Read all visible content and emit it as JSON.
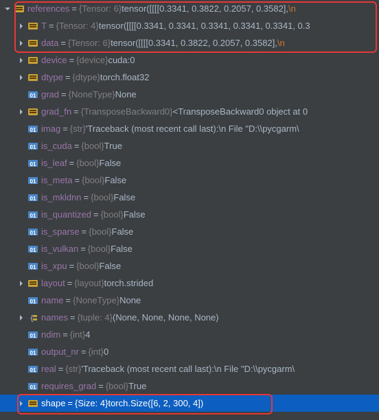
{
  "rows": [
    {
      "id": "references",
      "indent": 0,
      "expand": "down",
      "icon": "struct",
      "name": "references",
      "type": "{Tensor: 6}",
      "value": "tensor([[[[0.3341, 0.3822, 0.2057, 0.3582],",
      "tail_esc": "\\n",
      "interact": true
    },
    {
      "id": "T",
      "indent": 1,
      "expand": "right",
      "icon": "struct",
      "name": "T",
      "type": "{Tensor: 4}",
      "value": "tensor([[[[0.3341, 0.3341, 0.3341, 0.3341, 0.3341, 0.3",
      "interact": true
    },
    {
      "id": "data",
      "indent": 1,
      "expand": "right",
      "icon": "struct",
      "name": "data",
      "type": "{Tensor: 6}",
      "value": "tensor([[[[0.3341, 0.3822, 0.2057, 0.3582],",
      "tail_esc": "\\n",
      "interact": true
    },
    {
      "id": "device",
      "indent": 1,
      "expand": "right",
      "icon": "struct",
      "name": "device",
      "type": "{device}",
      "value": "cuda:0",
      "interact": true
    },
    {
      "id": "dtype",
      "indent": 1,
      "expand": "right",
      "icon": "struct",
      "name": "dtype",
      "type": "{dtype}",
      "value": "torch.float32",
      "interact": true
    },
    {
      "id": "grad",
      "indent": 1,
      "expand": "none",
      "icon": "01",
      "name": "grad",
      "type": "{NoneType}",
      "value": "None",
      "interact": true
    },
    {
      "id": "grad_fn",
      "indent": 1,
      "expand": "right",
      "icon": "struct",
      "name": "grad_fn",
      "type": "{TransposeBackward0}",
      "value": "<TransposeBackward0 object at 0",
      "interact": true
    },
    {
      "id": "imag",
      "indent": 1,
      "expand": "none",
      "icon": "01",
      "name": "imag",
      "type": "{str}",
      "value": "'Traceback (most recent call last):\\n  File \"D:\\\\pycgarm\\",
      "interact": true
    },
    {
      "id": "is_cuda",
      "indent": 1,
      "expand": "none",
      "icon": "01",
      "name": "is_cuda",
      "type": "{bool}",
      "value": "True",
      "interact": true
    },
    {
      "id": "is_leaf",
      "indent": 1,
      "expand": "none",
      "icon": "01",
      "name": "is_leaf",
      "type": "{bool}",
      "value": "False",
      "interact": true
    },
    {
      "id": "is_meta",
      "indent": 1,
      "expand": "none",
      "icon": "01",
      "name": "is_meta",
      "type": "{bool}",
      "value": "False",
      "interact": true
    },
    {
      "id": "is_mkldnn",
      "indent": 1,
      "expand": "none",
      "icon": "01",
      "name": "is_mkldnn",
      "type": "{bool}",
      "value": "False",
      "interact": true
    },
    {
      "id": "is_quantized",
      "indent": 1,
      "expand": "none",
      "icon": "01",
      "name": "is_quantized",
      "type": "{bool}",
      "value": "False",
      "interact": true
    },
    {
      "id": "is_sparse",
      "indent": 1,
      "expand": "none",
      "icon": "01",
      "name": "is_sparse",
      "type": "{bool}",
      "value": "False",
      "interact": true
    },
    {
      "id": "is_vulkan",
      "indent": 1,
      "expand": "none",
      "icon": "01",
      "name": "is_vulkan",
      "type": "{bool}",
      "value": "False",
      "interact": true
    },
    {
      "id": "is_xpu",
      "indent": 1,
      "expand": "none",
      "icon": "01",
      "name": "is_xpu",
      "type": "{bool}",
      "value": "False",
      "interact": true
    },
    {
      "id": "layout",
      "indent": 1,
      "expand": "right",
      "icon": "struct",
      "name": "layout",
      "type": "{layout}",
      "value": "torch.strided",
      "interact": true
    },
    {
      "id": "name",
      "indent": 1,
      "expand": "none",
      "icon": "01",
      "name": "name",
      "type": "{NoneType}",
      "value": "None",
      "interact": true
    },
    {
      "id": "names",
      "indent": 1,
      "expand": "right",
      "icon": "tuple",
      "name": "names",
      "type": "{tuple: 4}",
      "value": "(None, None, None, None)",
      "interact": true
    },
    {
      "id": "ndim",
      "indent": 1,
      "expand": "none",
      "icon": "01",
      "name": "ndim",
      "type": "{int}",
      "value": "4",
      "interact": true
    },
    {
      "id": "output_nr",
      "indent": 1,
      "expand": "none",
      "icon": "01",
      "name": "output_nr",
      "type": "{int}",
      "value": "0",
      "interact": true
    },
    {
      "id": "real",
      "indent": 1,
      "expand": "none",
      "icon": "01",
      "name": "real",
      "type": "{str}",
      "value": "'Traceback (most recent call last):\\n  File \"D:\\\\pycgarm\\",
      "interact": true
    },
    {
      "id": "requires_grad",
      "indent": 1,
      "expand": "none",
      "icon": "01",
      "name": "requires_grad",
      "type": "{bool}",
      "value": "True",
      "interact": true
    },
    {
      "id": "shape",
      "indent": 1,
      "expand": "right",
      "icon": "struct",
      "name": "shape",
      "type": "{Size: 4}",
      "value": "torch.Size([6, 2, 300, 4])",
      "selected": true,
      "interact": true
    }
  ],
  "icons": {
    "expand_right": "chevron-right-icon",
    "expand_down": "chevron-down-icon",
    "struct": "struct-icon",
    "prim": "primitive-01-icon",
    "tuple": "tuple-icon"
  }
}
